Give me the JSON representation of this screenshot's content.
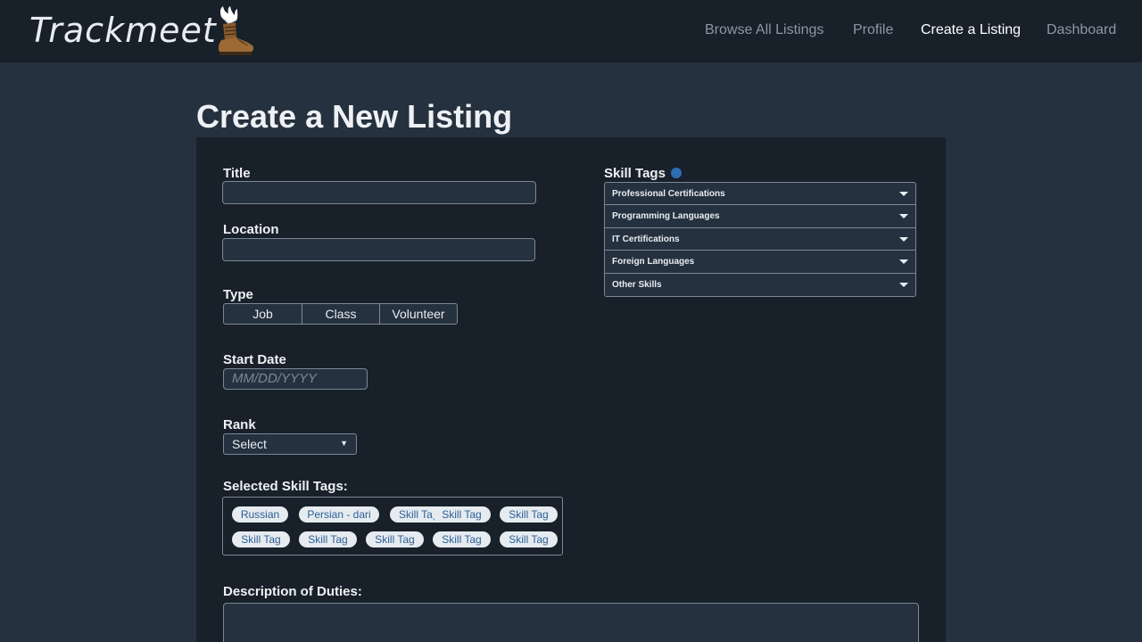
{
  "brand": {
    "name": "Trackmeet",
    "logo_icon": "winged-boot-icon"
  },
  "nav": {
    "items": [
      {
        "label": "Browse All Listings",
        "active": false
      },
      {
        "label": "Profile",
        "active": false
      },
      {
        "label": "Create a Listing",
        "active": true
      },
      {
        "label": "Dashboard",
        "active": false
      }
    ]
  },
  "page": {
    "title": "Create a New Listing"
  },
  "form": {
    "title_label": "Title",
    "title_value": "",
    "location_label": "Location",
    "location_value": "",
    "type_label": "Type",
    "type_options": [
      "Job",
      "Class",
      "Volunteer"
    ],
    "start_date_label": "Start Date",
    "start_date_placeholder": "MM/DD/YYYY",
    "rank_label": "Rank",
    "rank_selected": "Select",
    "selected_tags_label": "Selected Skill Tags:",
    "selected_tags": [
      "Russian",
      "Persian - dari",
      "Skill Tag",
      "Skill Tag",
      "Skill Tag",
      "Skill Tag",
      "Skill Tag",
      "Skill Tag",
      "Skill Tag",
      "Skill Tag"
    ],
    "description_label": "Description of Duties:",
    "description_value": ""
  },
  "skill_tags": {
    "label": "Skill Tags",
    "categories": [
      "Professional Certifications",
      "Programming Languages",
      "IT Certifications",
      "Foreign Languages",
      "Other Skills"
    ]
  },
  "colors": {
    "page_bg": "#25313f",
    "panel_bg": "#18202a",
    "chip_bg": "#e6ebf0",
    "chip_text": "#2c5f96",
    "info_dot": "#2d6db4"
  }
}
